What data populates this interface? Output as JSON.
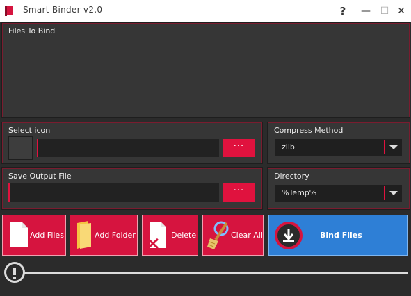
{
  "window": {
    "title": "Smart Binder v2.0",
    "help_glyph": "?",
    "minimize_glyph": "—",
    "maximize_glyph": "☐",
    "close_glyph": "✕"
  },
  "files_panel": {
    "label": "Files To Bind"
  },
  "icon_panel": {
    "label": "Select icon",
    "path": "",
    "browse_label": "···"
  },
  "compress_panel": {
    "label": "Compress Method",
    "selected": "zlib"
  },
  "output_panel": {
    "label": "Save Output File",
    "path": "",
    "browse_label": "···"
  },
  "directory_panel": {
    "label": "Directory",
    "selected": "%Temp%"
  },
  "actions": {
    "add_files": "Add Files",
    "add_folder": "Add Folder",
    "delete": "Delete",
    "clear_all": "Clear All",
    "bind_files": "Bind Files"
  },
  "progress": {
    "value": 0
  },
  "colors": {
    "accent": "#e0123e",
    "bind_button": "#2e7fd6",
    "panel_bg": "#363636",
    "panel_border": "#7a1c2f",
    "window_bg": "#2b2b2b"
  },
  "icons": [
    "app-icon",
    "file-icon",
    "folder-icon",
    "delete-file-icon",
    "broom-icon",
    "download-icon",
    "alert-icon"
  ]
}
